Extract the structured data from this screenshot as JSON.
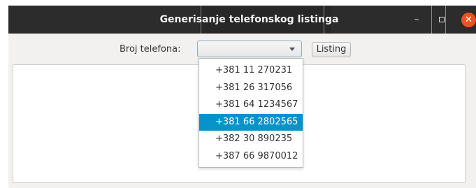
{
  "window": {
    "title": "Generisanje telefonskog listinga",
    "controls": {
      "minimize_icon": "–",
      "maximize_icon": "□",
      "close_icon": "✕",
      "close_color": "#e95420"
    }
  },
  "form": {
    "phone_label": "Broj telefona:",
    "phone_selected": "",
    "listing_button": "Listing"
  },
  "dropdown": {
    "options": [
      "+381 11 270231",
      "+381 26 317056",
      "+381 64 1234567",
      "+381 66 2802565",
      "+382 30 890235",
      "+387 66 9870012"
    ],
    "highlighted": "+381 66 2802565",
    "highlight_color": "#0793c8"
  },
  "output": {
    "text": ""
  }
}
